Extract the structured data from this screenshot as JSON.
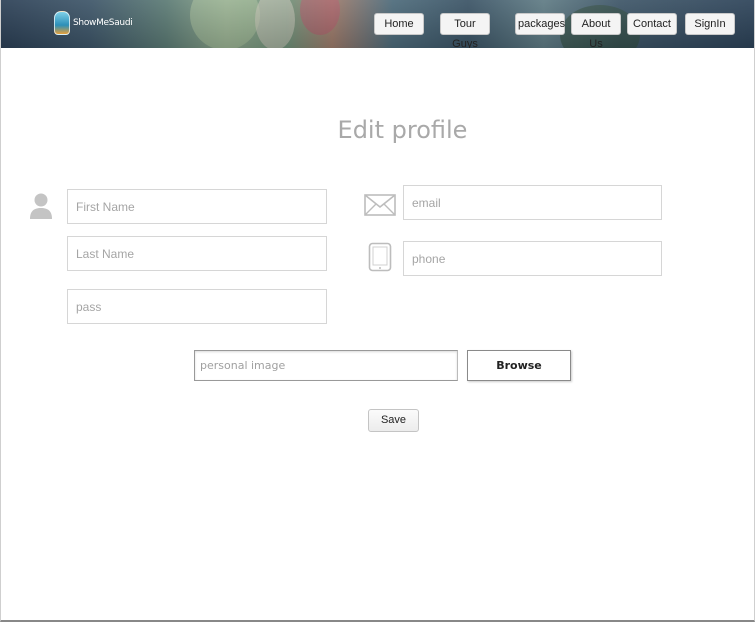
{
  "header": {
    "logo_text": "ShowMeSaudi",
    "nav": [
      {
        "label": "Home"
      },
      {
        "label": "Tour Guys"
      },
      {
        "label": "packages"
      },
      {
        "label": "About Us"
      },
      {
        "label": "Contact"
      },
      {
        "label": "SignIn"
      }
    ]
  },
  "main": {
    "title": "Edit profile",
    "fields": {
      "first_name": {
        "placeholder": "First Name",
        "value": ""
      },
      "last_name": {
        "placeholder": "Last Name",
        "value": ""
      },
      "pass": {
        "placeholder": "pass",
        "value": ""
      },
      "email": {
        "placeholder": "email",
        "value": ""
      },
      "phone": {
        "placeholder": "phone",
        "value": ""
      },
      "personal_image": {
        "placeholder": "personal image",
        "value": ""
      }
    },
    "browse_label": "Browse",
    "save_label": "Save"
  },
  "icons": {
    "user": "user-icon",
    "email": "envelope-icon",
    "phone": "tablet-icon"
  },
  "colors": {
    "title": "#a9a9a9",
    "icon": "#c4c4c4",
    "field_border": "#d6d6d6"
  }
}
